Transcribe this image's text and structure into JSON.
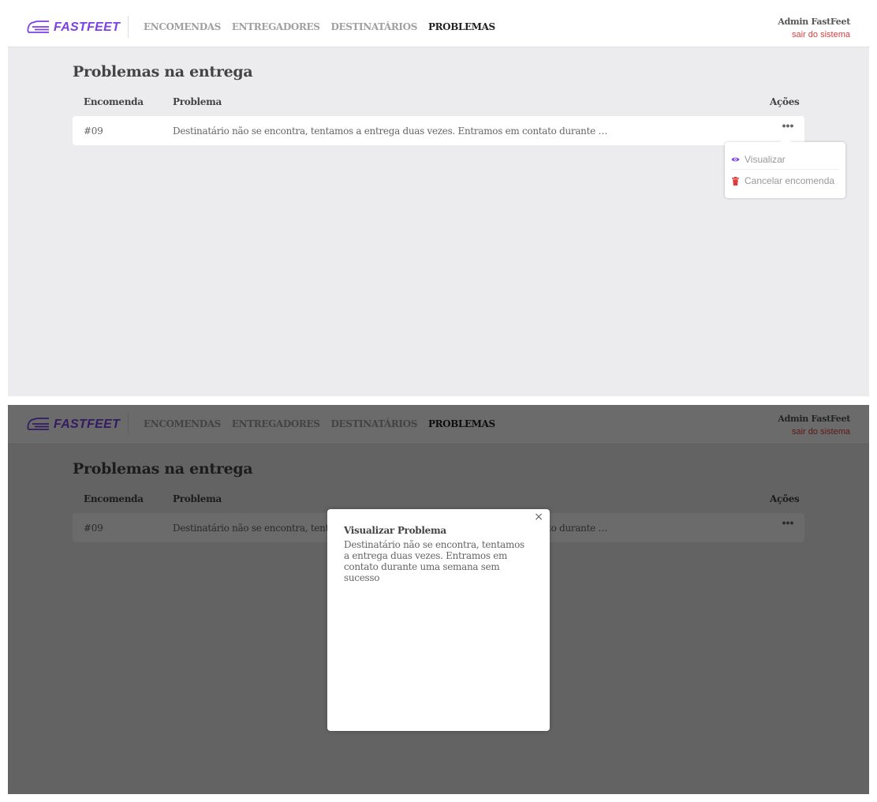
{
  "brand": {
    "name": "FASTFEET",
    "color": "#7d40e7"
  },
  "nav": {
    "items": [
      {
        "label": "ENCOMENDAS"
      },
      {
        "label": "ENTREGADORES"
      },
      {
        "label": "DESTINATÁRIOS"
      },
      {
        "label": "PROBLEMAS"
      }
    ],
    "active": "PROBLEMAS"
  },
  "user": {
    "name": "Admin FastFeet",
    "logout": "sair do sistema"
  },
  "page": {
    "title": "Problemas na entrega"
  },
  "table": {
    "headers": [
      "Encomenda",
      "Problema",
      "Ações"
    ],
    "rows": [
      {
        "id": "#09",
        "problem": "Destinatário não se encontra, tentamos a entrega duas vezes. Entramos em contato durante …",
        "actions": "•••"
      }
    ]
  },
  "actions_menu": {
    "items": [
      {
        "label": "Visualizar",
        "icon": "eye-icon",
        "color": "#7d40e7"
      },
      {
        "label": "Cancelar encomenda",
        "icon": "trash-icon",
        "color": "#de3b3b"
      }
    ]
  },
  "modal": {
    "close": "×",
    "title": "Visualizar Problema",
    "text": "Destinatário não se encontra, tentamos a entrega duas vezes. Entramos em contato durante uma semana sem sucesso"
  },
  "colors": {
    "accent": "#7d40e7",
    "danger": "#de3b3b",
    "background": "#ececee"
  }
}
